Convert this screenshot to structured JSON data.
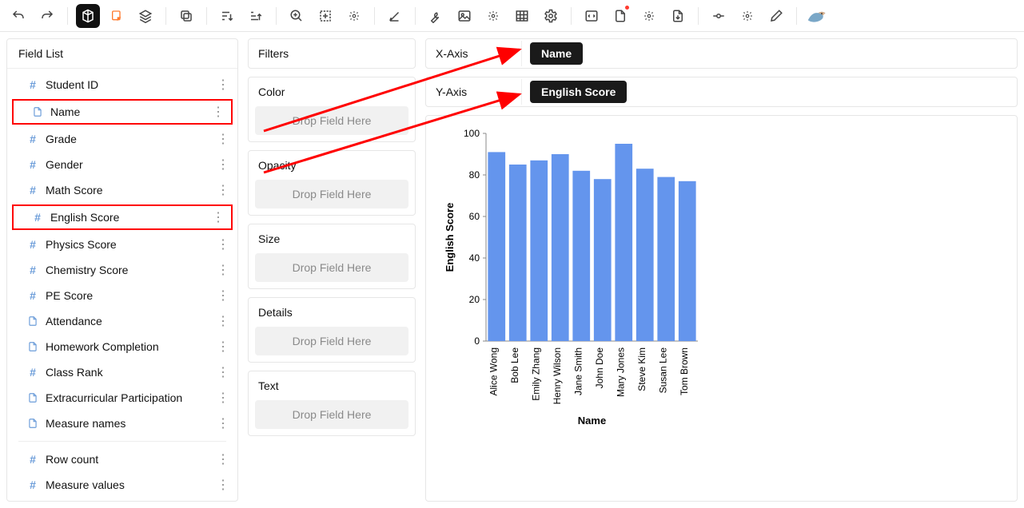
{
  "fieldListTitle": "Field List",
  "fields": [
    {
      "icon": "hash",
      "label": "Student ID",
      "highlight": false
    },
    {
      "icon": "page",
      "label": "Name",
      "highlight": true
    },
    {
      "icon": "hash",
      "label": "Grade",
      "highlight": false
    },
    {
      "icon": "hash",
      "label": "Gender",
      "highlight": false
    },
    {
      "icon": "hash",
      "label": "Math Score",
      "highlight": false
    },
    {
      "icon": "hash",
      "label": "English Score",
      "highlight": true
    },
    {
      "icon": "hash",
      "label": "Physics Score",
      "highlight": false
    },
    {
      "icon": "hash",
      "label": "Chemistry Score",
      "highlight": false
    },
    {
      "icon": "hash",
      "label": "PE Score",
      "highlight": false
    },
    {
      "icon": "page",
      "label": "Attendance",
      "highlight": false
    },
    {
      "icon": "page",
      "label": "Homework Completion",
      "highlight": false
    },
    {
      "icon": "hash",
      "label": "Class Rank",
      "highlight": false
    },
    {
      "icon": "page",
      "label": "Extracurricular Participation",
      "highlight": false
    },
    {
      "icon": "page",
      "label": "Measure names",
      "highlight": false
    }
  ],
  "extraFields": [
    {
      "icon": "hash",
      "label": "Row count"
    },
    {
      "icon": "hash",
      "label": "Measure values"
    }
  ],
  "shelves": {
    "filters": "Filters",
    "color": "Color",
    "opacity": "Opacity",
    "size": "Size",
    "details": "Details",
    "text": "Text",
    "drop": "Drop Field Here"
  },
  "axis": {
    "xLabel": "X-Axis",
    "yLabel": "Y-Axis",
    "xPill": "Name",
    "yPill": "English Score"
  },
  "chart_data": {
    "type": "bar",
    "title": "",
    "xlabel": "Name",
    "ylabel": "English Score",
    "ylim": [
      0,
      100
    ],
    "yticks": [
      0,
      20,
      40,
      60,
      80,
      100
    ],
    "categories": [
      "Alice Wong",
      "Bob Lee",
      "Emily Zhang",
      "Henry Wilson",
      "Jane Smith",
      "John Doe",
      "Mary Jones",
      "Steve Kim",
      "Susan Lee",
      "Tom Brown"
    ],
    "values": [
      91,
      85,
      87,
      90,
      82,
      78,
      95,
      83,
      79,
      77
    ],
    "barColor": "#6495ed"
  }
}
